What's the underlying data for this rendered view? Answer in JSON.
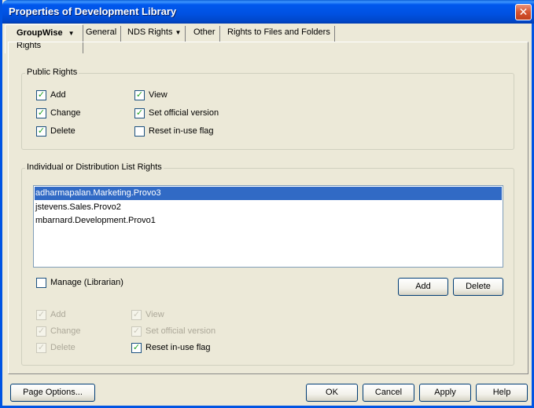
{
  "window": {
    "title": "Properties of Development Library"
  },
  "tabs": {
    "active": {
      "label": "GroupWise",
      "sublabel": "Rights"
    },
    "others": [
      {
        "label": "General",
        "has_menu": false
      },
      {
        "label": "NDS Rights",
        "has_menu": true
      },
      {
        "label": "Other",
        "has_menu": false
      },
      {
        "label": "Rights to Files and Folders",
        "has_menu": false
      }
    ]
  },
  "public_rights": {
    "legend": "Public Rights",
    "items": [
      {
        "label": "Add",
        "checked": true
      },
      {
        "label": "Change",
        "checked": true
      },
      {
        "label": "Delete",
        "checked": true
      },
      {
        "label": "View",
        "checked": true
      },
      {
        "label": "Set official version",
        "checked": true
      },
      {
        "label": "Reset in-use flag",
        "checked": false
      }
    ]
  },
  "individual_rights": {
    "legend": "Individual or Distribution List Rights",
    "list": [
      {
        "text": "adharmapalan.Marketing.Provo3",
        "selected": true
      },
      {
        "text": "jstevens.Sales.Provo2",
        "selected": false
      },
      {
        "text": "mbarnard.Development.Provo1",
        "selected": false
      }
    ],
    "manage": {
      "label": "Manage (Librarian)",
      "checked": false
    },
    "add_label": "Add",
    "delete_label": "Delete",
    "items": [
      {
        "label": "Add",
        "checked": true,
        "enabled": false
      },
      {
        "label": "Change",
        "checked": true,
        "enabled": false
      },
      {
        "label": "Delete",
        "checked": true,
        "enabled": false
      },
      {
        "label": "View",
        "checked": true,
        "enabled": false
      },
      {
        "label": "Set official version",
        "checked": true,
        "enabled": false
      },
      {
        "label": "Reset in-use flag",
        "checked": true,
        "enabled": true
      }
    ]
  },
  "footer": {
    "page_options": "Page Options...",
    "ok": "OK",
    "cancel": "Cancel",
    "apply": "Apply",
    "help": "Help"
  },
  "colors": {
    "titlebar": "#0058ee",
    "selection": "#316ac5",
    "face": "#ece9d8"
  }
}
